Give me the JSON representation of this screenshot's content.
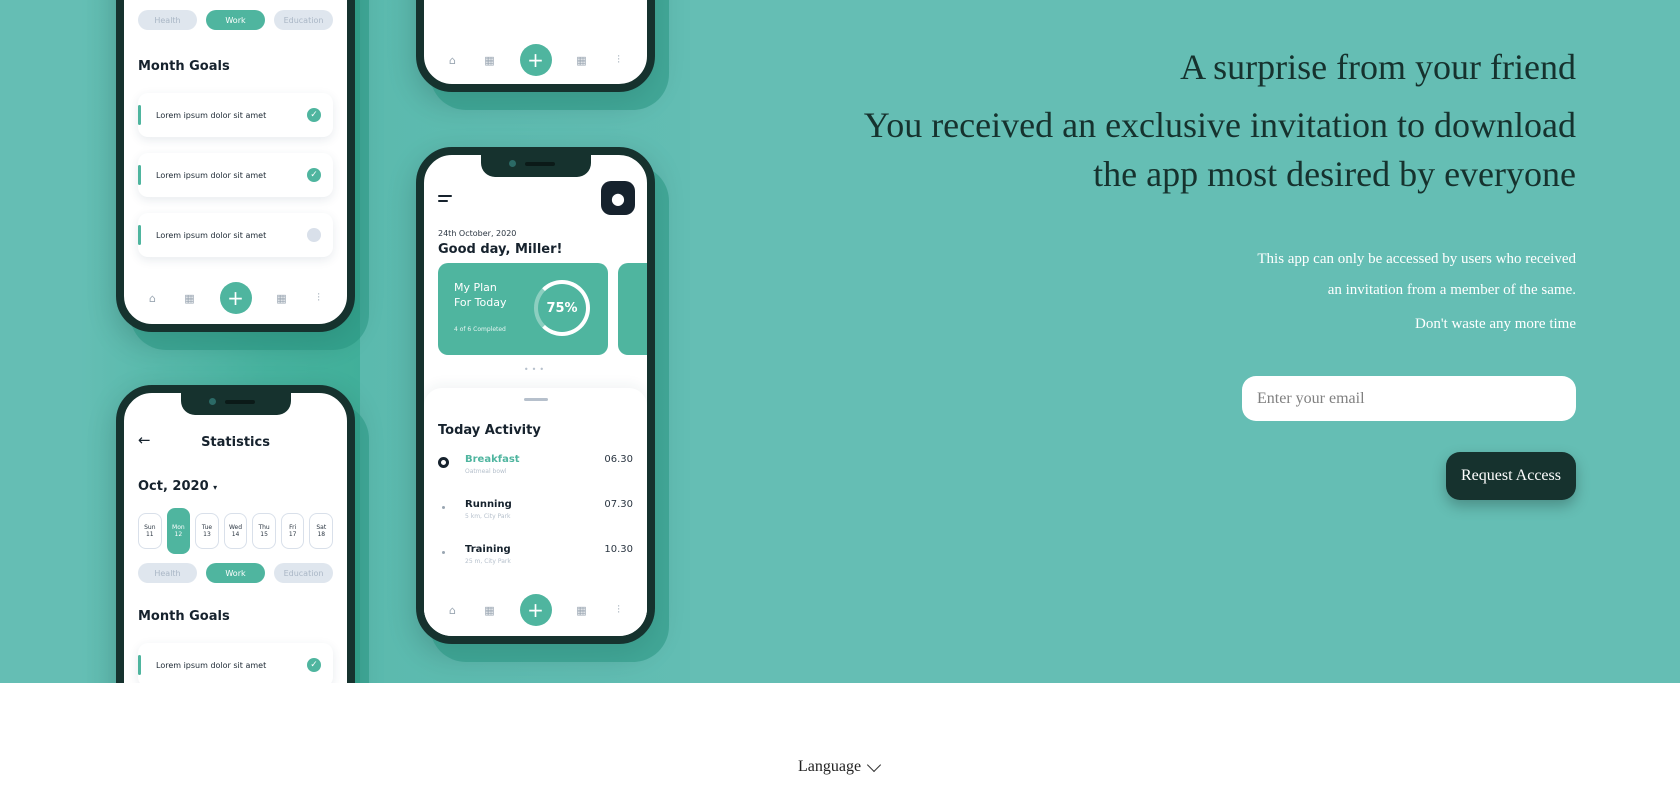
{
  "hero": {
    "title": "A surprise from your friend",
    "subtitle_line1": "You received an exclusive invitation to download",
    "subtitle_line2": "the app most desired by everyone",
    "body_line1": "This app can only be accessed by users who received",
    "body_line2": "an invitation from a member of the same.",
    "body_line3": "Don't waste any more time",
    "email_placeholder": "Enter your email",
    "email_value": "",
    "cta_label": "Request Access",
    "background_color": "#65beb4",
    "dark_color": "#16322e"
  },
  "footer": {
    "language_label": "Language"
  },
  "phone_goals": {
    "tags": [
      "Health",
      "Work",
      "Education"
    ],
    "selected_tag": "Work",
    "month_goals_title": "Month Goals",
    "goals": [
      {
        "text": "Lorem ipsum dolor sit amet",
        "done": true
      },
      {
        "text": "Lorem ipsum dolor sit amet",
        "done": true
      },
      {
        "text": "Lorem ipsum dolor sit amet",
        "done": false
      }
    ]
  },
  "phone_stats": {
    "title": "Statistics",
    "month": "Oct, 2020",
    "days": [
      {
        "d": "Sun",
        "n": "11"
      },
      {
        "d": "Mon",
        "n": "12"
      },
      {
        "d": "Tue",
        "n": "13"
      },
      {
        "d": "Wed",
        "n": "14"
      },
      {
        "d": "Thu",
        "n": "15"
      },
      {
        "d": "Fri",
        "n": "17"
      },
      {
        "d": "Sat",
        "n": "18"
      }
    ],
    "tags": [
      "Health",
      "Work",
      "Education"
    ],
    "month_goals_title": "Month Goals",
    "goal_text": "Lorem ipsum dolor sit amet"
  },
  "phone_dashboard": {
    "date": "24th October, 2020",
    "greeting": "Good day, Miller!",
    "plan_line1": "My Plan",
    "plan_line2": "For Today",
    "plan_sub": "4 of 6 Completed",
    "plan_percent": "75%",
    "activity_title": "Today Activity",
    "activities": [
      {
        "name": "Breakfast",
        "sub": "Oatmeal bowl",
        "time": "06.30"
      },
      {
        "name": "Running",
        "sub": "5 km, City Park",
        "time": "07.30"
      },
      {
        "name": "Training",
        "sub": "25 m, City Park",
        "time": "10.30"
      }
    ]
  }
}
